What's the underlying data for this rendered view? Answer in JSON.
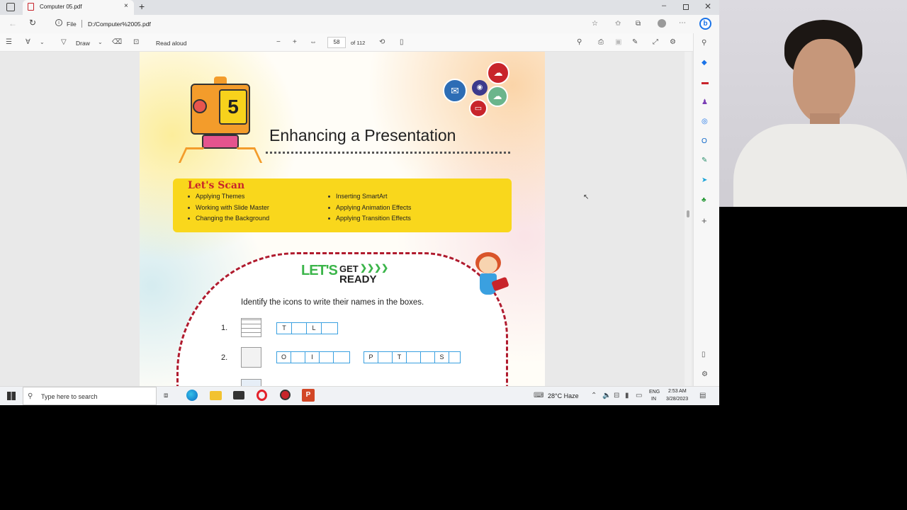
{
  "browser": {
    "tab_title": "Computer 05.pdf",
    "new_tab": "+",
    "address_prefix": "File",
    "address_url": "D:/Computer%2005.pdf"
  },
  "pdf_toolbar": {
    "draw_label": "Draw",
    "read_aloud_label": "Read aloud",
    "page_number": "58",
    "page_total": "of 112"
  },
  "document": {
    "chapter_number": "5",
    "title": "Enhancing a Presentation",
    "scan_heading": "Let's Scan",
    "scan_left": [
      "Applying Themes",
      "Working with Slide Master",
      "Changing the Background"
    ],
    "scan_right": [
      "Inserting SmartArt",
      "Applying Animation Effects",
      "Applying Transition Effects"
    ],
    "lets_label": "LET'S",
    "get_label": "GET",
    "ready_label": "READY",
    "instruction": "Identify the icons to write their names in the boxes.",
    "q1_num": "1.",
    "q2_num": "2.",
    "q1_letters": [
      "T",
      "",
      "L",
      ""
    ],
    "q2a_letters": [
      "O",
      "",
      "I",
      "",
      ""
    ],
    "q2b_letters": [
      "P",
      "",
      "T",
      "",
      "",
      "S"
    ]
  },
  "taskbar": {
    "search_placeholder": "Type here to search",
    "weather": "28°C Haze",
    "lang_top": "ENG",
    "lang_bottom": "IN",
    "time": "2:53 AM",
    "date": "3/28/2023"
  },
  "colors": {
    "scan_yellow": "#f9d71c",
    "scan_heading": "#c8242b",
    "dashed_border": "#b01b2e",
    "ready_green": "#3bb54a",
    "box_border": "#3aa0e0"
  }
}
